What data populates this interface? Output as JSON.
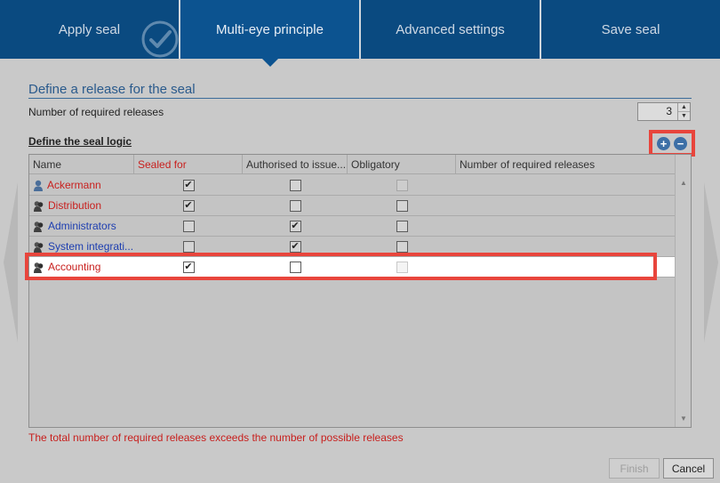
{
  "wizard": {
    "tabs": [
      {
        "label": "Apply seal",
        "state": "done"
      },
      {
        "label": "Multi-eye principle",
        "state": "active"
      },
      {
        "label": "Advanced settings",
        "state": "pending"
      },
      {
        "label": "Save seal",
        "state": "pending"
      }
    ]
  },
  "section": {
    "title": "Define a release for the seal",
    "required_label": "Number of required releases",
    "required_value": "3",
    "logic_label": "Define the seal logic"
  },
  "grid": {
    "headers": [
      "Name",
      "Sealed for",
      "Authorised to issue...",
      "Obligatory",
      "Number of required releases"
    ],
    "rows": [
      {
        "name": "Ackermann",
        "icon": "user-icon",
        "name_color": "red",
        "sealed_for": true,
        "authorised": false,
        "obligatory": false
      },
      {
        "name": "Distribution",
        "icon": "group-icon",
        "name_color": "red",
        "sealed_for": true,
        "authorised": false,
        "obligatory": false
      },
      {
        "name": "Administrators",
        "icon": "group-icon",
        "name_color": "blue",
        "sealed_for": false,
        "authorised": true,
        "obligatory": false
      },
      {
        "name": "System integrati...",
        "icon": "group-icon",
        "name_color": "blue",
        "sealed_for": false,
        "authorised": true,
        "obligatory": false
      },
      {
        "name": "Accounting",
        "icon": "group-icon",
        "name_color": "red",
        "sealed_for": true,
        "authorised": false,
        "obligatory": false,
        "highlighted": true
      }
    ]
  },
  "warning": "The total number of required releases exceeds the number of possible releases",
  "buttons": {
    "finish": "Finish",
    "cancel": "Cancel"
  },
  "colors": {
    "tab_bg": "#0a4a80",
    "accent_red": "#e8453c",
    "name_red": "#c8201e",
    "name_blue": "#1d3eb0"
  }
}
